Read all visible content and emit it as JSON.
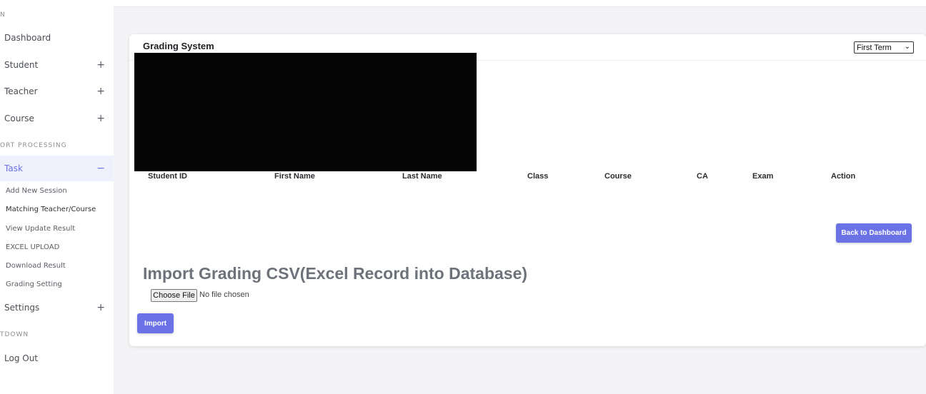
{
  "sidebar": {
    "sections": [
      "N",
      "ORT PROCESSING",
      "TDOWN"
    ],
    "items": [
      {
        "label": "Dashboard",
        "expand": ""
      },
      {
        "label": "Student",
        "expand": "+"
      },
      {
        "label": "Teacher",
        "expand": "+"
      },
      {
        "label": "Course",
        "expand": "+"
      },
      {
        "label": "Task",
        "expand": "−"
      },
      {
        "label": "Settings",
        "expand": "+"
      },
      {
        "label": "Log Out",
        "expand": ""
      }
    ],
    "task_subitems": [
      "Add New Session",
      "Matching Teacher/Course",
      "View Update Result",
      "EXCEL UPLOAD",
      "Download Result",
      "Grading Setting"
    ]
  },
  "card": {
    "title": "Grading System",
    "term_select": {
      "value": "First Term",
      "chevron": "⌄"
    },
    "table_headers": [
      "Student ID",
      "First Name",
      "Last Name",
      "Class",
      "Course",
      "CA",
      "Exam",
      "Action"
    ],
    "back_button": "Back to Dashboard",
    "import_title": "Import Grading CSV(Excel Record into Database)",
    "choose_file": "Choose File",
    "file_status": "No file chosen",
    "import_button": "Import"
  },
  "colors": {
    "accent": "#6a72e6",
    "background": "#f4f4f6"
  }
}
